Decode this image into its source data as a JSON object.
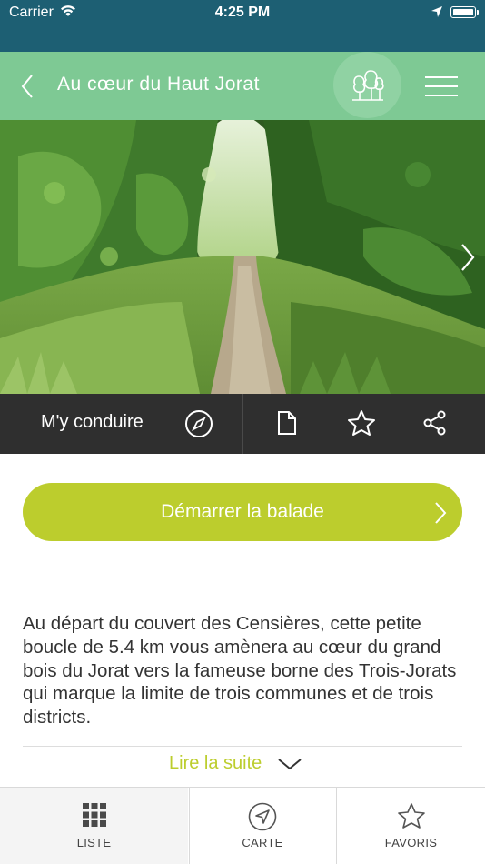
{
  "status_bar": {
    "carrier": "Carrier",
    "time": "4:25 PM"
  },
  "header": {
    "title": "Au cœur du Haut Jorat",
    "back_icon": "chevron-left-icon",
    "logo_icon": "trees-icon",
    "menu_icon": "hamburger-menu-icon"
  },
  "actions": {
    "guide_label": "M'y conduire",
    "icons": [
      "compass-icon",
      "document-icon",
      "star-icon",
      "share-icon"
    ]
  },
  "start_button": {
    "label": "Démarrer la balade"
  },
  "description": {
    "text": "Au départ du couvert des Censières, cette petite boucle de 5.4 km vous amènera au cœur du grand bois du Jorat vers la fameuse borne des Trois-Jorats qui marque la limite de trois communes et de trois districts.",
    "more_label": "Lire la suite"
  },
  "tabs": [
    {
      "label": "LISTE",
      "icon": "grid-icon"
    },
    {
      "label": "CARTE",
      "icon": "navigation-arrow-icon"
    },
    {
      "label": "FAVORIS",
      "icon": "star-icon"
    }
  ],
  "colors": {
    "status_bar": "#1d5f73",
    "header": "#7ec994",
    "accent": "#bccd2d",
    "action_bar": "#2f2f2f"
  }
}
